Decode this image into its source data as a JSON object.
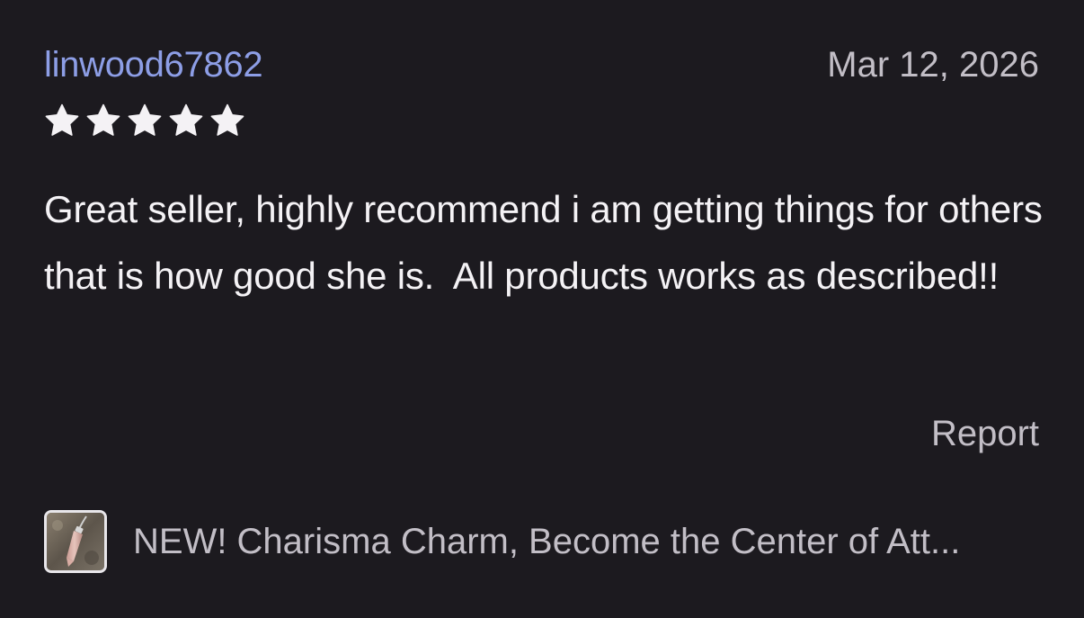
{
  "review": {
    "username": "linwood67862",
    "date": "Mar 12, 2026",
    "rating": 5,
    "rating_max": 5,
    "text": "Great seller, highly recommend i am getting things for others that is how good she is.  All products works as described!!",
    "report_label": "Report"
  },
  "product": {
    "title": "NEW! Charisma Charm, Become the Center of Att..."
  },
  "colors": {
    "background": "#1c1a1f",
    "username": "#8d9ee6",
    "text": "#f4f2f5",
    "muted": "#c2bec6",
    "star": "#f4f2f5"
  },
  "icons": {
    "star": "star-icon",
    "thumbnail": "product-thumbnail"
  }
}
